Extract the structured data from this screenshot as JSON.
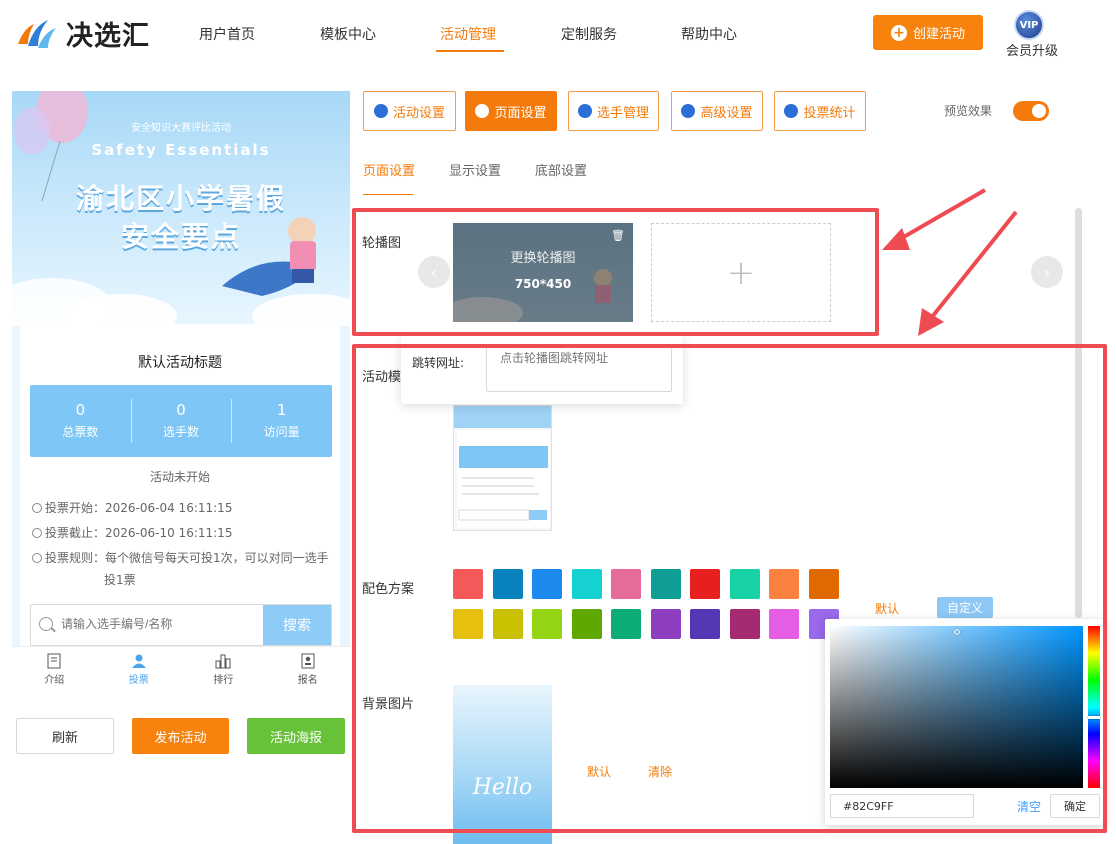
{
  "header": {
    "brand": "决选汇",
    "nav": [
      "用户首页",
      "模板中心",
      "活动管理",
      "定制服务",
      "帮助中心"
    ],
    "active_nav": "活动管理",
    "create_button": "创建活动",
    "vip_badge": "VIP",
    "vip_label": "会员升级"
  },
  "preview": {
    "banner": {
      "subtitle": "安全知识大赛评比活动",
      "english": "Safety Essentials",
      "title_line1": "渝北区小学暑假",
      "title_line2": "安全要点"
    },
    "card_title": "默认活动标题",
    "stats": [
      {
        "value": "0",
        "label": "总票数"
      },
      {
        "value": "0",
        "label": "选手数"
      },
      {
        "value": "1",
        "label": "访问量"
      }
    ],
    "status": "活动未开始",
    "vote_start": "投票开始：2026-06-04 16:11:15",
    "vote_end": "投票截止：2026-06-10 16:11:15",
    "rule_line1": "投票规则：每个微信号每天可投1次，可以对同一选手",
    "rule_line2": "投1票",
    "search_placeholder": "请输入选手编号/名称",
    "search_button": "搜索",
    "tabs": [
      "介绍",
      "投票",
      "排行",
      "报名"
    ],
    "active_tab": "投票"
  },
  "actions": {
    "refresh": "刷新",
    "publish": "发布活动",
    "poster": "活动海报"
  },
  "settings": {
    "top_tabs": [
      "活动设置",
      "页面设置",
      "选手管理",
      "高级设置",
      "投票统计"
    ],
    "active_top_tab": "页面设置",
    "preview_label": "预览效果",
    "preview_enabled": true,
    "sub_tabs": [
      "页面设置",
      "显示设置",
      "底部设置"
    ],
    "active_sub_tab": "页面设置",
    "carousel_label": "轮播图",
    "carousel_replace": "更换轮播图",
    "carousel_size": "750*450",
    "jump_label": "跳转网址:",
    "jump_placeholder": "点击轮播图跳转网址",
    "template_label": "活动模",
    "color_label": "配色方案",
    "color_default": "默认",
    "color_custom": "自定义",
    "swatches_row1": [
      "#f45a5a",
      "#0a82bd",
      "#1e8af0",
      "#16d1d2",
      "#e66a9a",
      "#0e9e96",
      "#e81f1f",
      "#18d2a5",
      "#fb8141",
      "#e06a00"
    ],
    "swatches_row2": [
      "#e6c00f",
      "#c8c000",
      "#94d414",
      "#5fa800",
      "#0cad74",
      "#8e3fc0",
      "#5536b5",
      "#a62a72",
      "#e45de4",
      "#9a69ec"
    ],
    "bg_label": "背景图片",
    "bg_hello": "Hello",
    "bg_default": "默认",
    "bg_clear": "清除"
  },
  "color_picker": {
    "hex": "#82C9FF",
    "clear": "清空",
    "confirm": "确定"
  },
  "colors": {
    "accent": "#f47b0b",
    "highlight_box": "#ef4b52",
    "stats_bg": "#7ec6f5",
    "publish": "#f7820d",
    "poster": "#67c23a"
  }
}
